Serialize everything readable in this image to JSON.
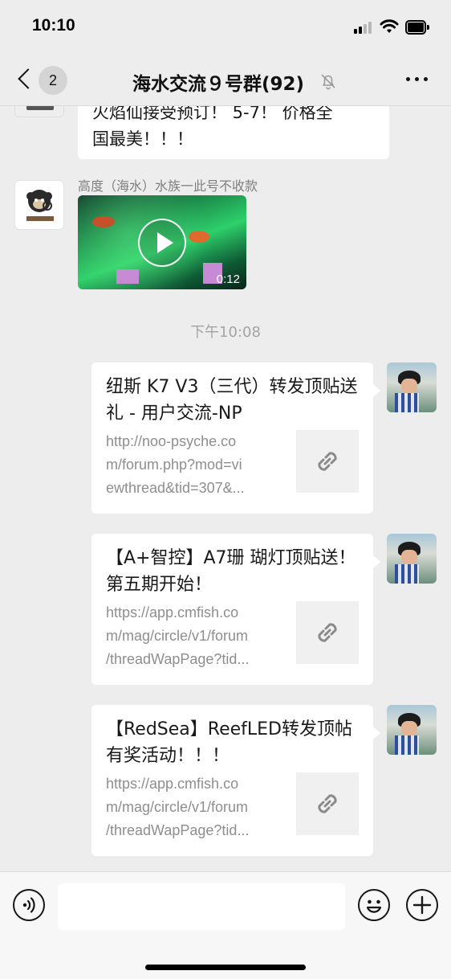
{
  "status_bar": {
    "time": "10:10",
    "signal_icon": "cellular-signal-icon",
    "wifi_icon": "wifi-icon",
    "battery_icon": "battery-icon"
  },
  "nav": {
    "back_icon": "chevron-left-icon",
    "unread_count": "2",
    "title": "海水交流９号群(92)",
    "mute_icon": "bell-slash-icon",
    "more_icon": "more-dots-icon"
  },
  "messages": [
    {
      "type": "text",
      "side": "left",
      "lines": [
        "火焰仙接受预订！ 5-7！ 价格全",
        "国最美！！！"
      ]
    },
    {
      "type": "video",
      "side": "left",
      "sender": "高度（海水）水族一此号不收款",
      "duration": "0:12",
      "play_icon": "play-icon"
    },
    {
      "type": "time",
      "text": "下午10:08"
    },
    {
      "type": "link",
      "side": "right",
      "title": "纽斯 K7 V3（三代）转发顶贴送礼 - 用户交流-NP",
      "url_lines": [
        "http://noo-psyche.co",
        "m/forum.php?mod=vi",
        "ewthread&tid=307&..."
      ],
      "thumb_icon": "link-icon"
    },
    {
      "type": "link",
      "side": "right",
      "title": "【A+智控】A7珊 瑚灯顶贴送！第五期开始！",
      "url_lines": [
        "https://app.cmfish.co",
        "m/mag/circle/v1/forum",
        "/threadWapPage?tid..."
      ],
      "thumb_icon": "link-icon"
    },
    {
      "type": "link",
      "side": "right",
      "title": "【RedSea】ReefLED转发顶帖有奖活动！！！",
      "url_lines": [
        "https://app.cmfish.co",
        "m/mag/circle/v1/forum",
        "/threadWapPage?tid..."
      ],
      "thumb_icon": "link-icon"
    }
  ],
  "input_bar": {
    "voice_icon": "voice-input-icon",
    "emoji_icon": "emoji-icon",
    "plus_icon": "plus-icon",
    "placeholder": ""
  },
  "colors": {
    "background": "#ededed",
    "bubble": "#ffffff",
    "secondary_text": "#7f7f7f"
  }
}
